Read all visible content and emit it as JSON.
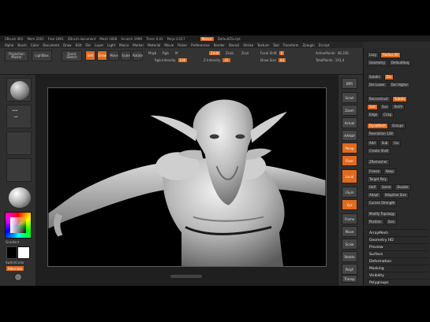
{
  "titlebar": {
    "items": [
      "ZBrush 4R2",
      "Mem 2001",
      "Free 1891",
      "ZBrush document",
      "Mesh 1668",
      "Scratch 1999",
      "Timer 0.01",
      "Polys 0.017",
      "ActivePoints"
    ],
    "right_button": "Menus",
    "right_label": "DefaultZScript"
  },
  "menubar": {
    "items": [
      "Alpha",
      "Brush",
      "Color",
      "Document",
      "Draw",
      "Edit",
      "File",
      "Layer",
      "Light",
      "Macro",
      "Marker",
      "Material",
      "Movie",
      "Picker",
      "Preferences",
      "Render",
      "Stencil",
      "Stroke",
      "Texture",
      "Tool",
      "Transform",
      "Zplugin",
      "Zscript"
    ]
  },
  "shelf": {
    "projection_master": "Projection Master",
    "lightbox": "LightBox",
    "quick_sketch": "Quick Sketch",
    "edit": "Edit",
    "draw": "Draw",
    "move": "Move",
    "scale": "Scale",
    "rotate": "Rotate",
    "mrgb": "Mrgb",
    "rgb": "Rgb",
    "m": "M",
    "zadd": "Zadd",
    "zsub": "Zsub",
    "zcut": "Zcut",
    "focal_shift": "Focal Shift",
    "focal_val": "0",
    "draw_size": "Draw Size",
    "draw_val": "64",
    "rgb_intensity": "Rgb Intensity",
    "rgb_val": "100",
    "z_intensity": "Z Intensity",
    "z_val": "25",
    "active_points": "ActivePoints:",
    "active_val": "48,336",
    "total_points": "TotalPoints:",
    "total_val": "193,4"
  },
  "lefttray": {
    "gradient_label": "Gradient",
    "switch_label": "SwitchColor",
    "alternate": "Alternate"
  },
  "rstrip": {
    "buttons": [
      "BPR",
      "Scroll",
      "Zoom",
      "Actual",
      "AAHalf",
      "Persp",
      "Floor",
      "Local",
      "LSym",
      "Xyz",
      "Frame",
      "Move",
      "Scale",
      "Rotate",
      "PolyF",
      "Transp",
      "Solo"
    ]
  },
  "rpanel": {
    "rows1": [
      [
        "Lazy",
        "Radius 60"
      ],
      [
        "Geometry",
        "DefaultSeq"
      ],
      [
        "Subdiv",
        "Div"
      ],
      [
        "Del Lower",
        "Del Higher"
      ],
      [
        "Reconstruct",
        "Subdiv"
      ],
      [
        "Smt",
        "Suv",
        "ReUV"
      ],
      [
        "Edge",
        "Crisp"
      ],
      [
        "DynaMesh",
        "Groups"
      ],
      [
        "Resolution 128"
      ],
      [
        "Add",
        "Sub",
        "Inv"
      ],
      [
        "Create Shell"
      ],
      [
        "ZRemesher"
      ],
      [
        "Freeze",
        "Keep"
      ],
      [
        "Target Poly"
      ],
      [
        "Half",
        "Same",
        "Double"
      ],
      [
        "Adapt",
        "Adaptive Size"
      ],
      [
        "Curves Strength"
      ],
      [
        "Modify Topology"
      ],
      [
        "Position",
        "Size"
      ],
      [
        "MeshIntegrity"
      ]
    ],
    "sections": [
      "ArrayMesh",
      "Geometry HD",
      "Preview",
      "Surface",
      "Deformation",
      "Masking",
      "Visibility",
      "Polygroups"
    ]
  },
  "colors": {
    "accent": "#e06a1d",
    "panel": "#2a2a2a",
    "canvas": "#000000"
  }
}
